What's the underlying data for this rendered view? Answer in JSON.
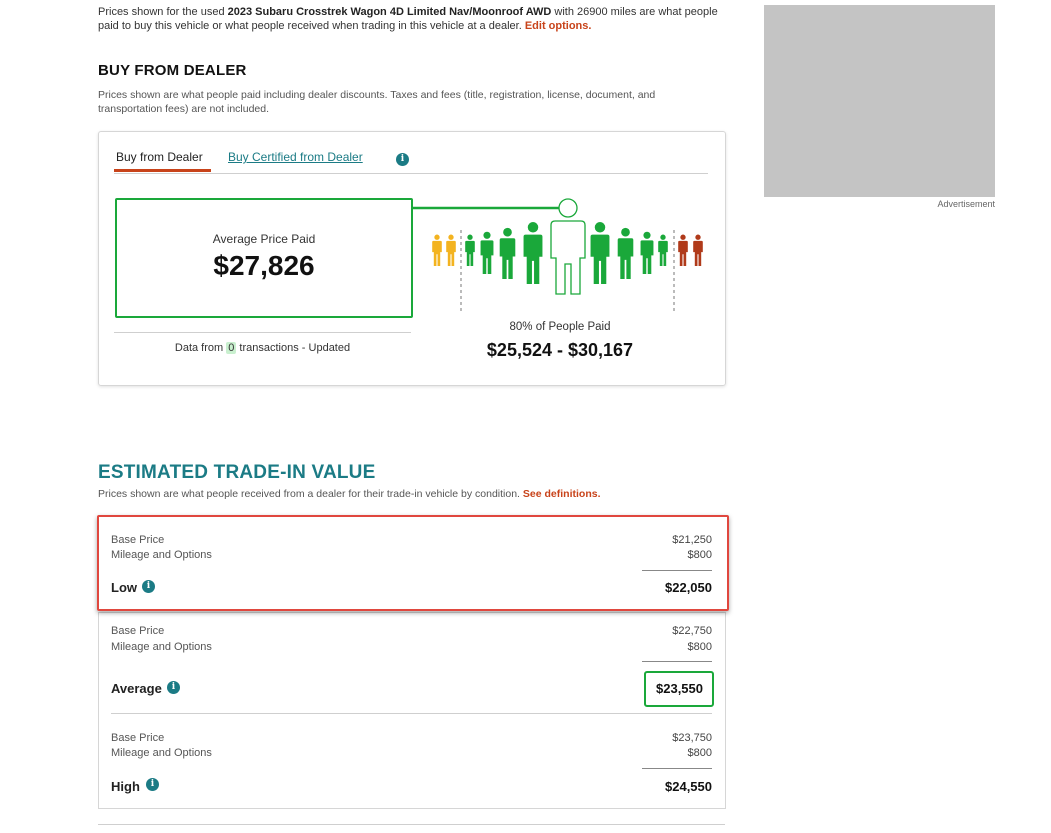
{
  "intro": {
    "prefix": "Prices shown for the used ",
    "vehicle": "2023 Subaru Crosstrek Wagon 4D Limited Nav/Moonroof AWD",
    "suffix": " with 26900 miles are what people paid to buy this vehicle or what people received when trading in this vehicle at a dealer. ",
    "edit_link": "Edit options."
  },
  "dealer": {
    "heading": "BUY FROM DEALER",
    "note": "Prices shown are what people paid including dealer discounts. Taxes and fees (title, registration, license, document, and transportation fees) are not included.",
    "tabs": [
      "Buy from Dealer",
      "Buy Certified from Dealer"
    ],
    "info_glyph": "i",
    "average_label": "Average Price Paid",
    "average_price": "$27,826",
    "data_from_prefix": "Data from ",
    "data_from_count": "0",
    "data_from_suffix": " transactions - Updated",
    "percent_label": "80% of People Paid",
    "price_range": "$25,524 - $30,167",
    "colors": {
      "low": "#f3b320",
      "mid": "#1aa83a",
      "high": "#b03a1a",
      "accent": "#c8431a"
    }
  },
  "trade": {
    "heading": "ESTIMATED TRADE-IN VALUE",
    "note_prefix": "Prices shown are what people received from a dealer for their trade-in vehicle by condition. ",
    "note_link": "See definitions.",
    "conditions": [
      {
        "name": "Low",
        "base_label": "Base Price",
        "base_value": "$21,250",
        "mileage_label": "Mileage and Options",
        "mileage_value": "$800",
        "total": "$22,050"
      },
      {
        "name": "Average",
        "base_label": "Base Price",
        "base_value": "$22,750",
        "mileage_label": "Mileage and Options",
        "mileage_value": "$800",
        "total": "$23,550"
      },
      {
        "name": "High",
        "base_label": "Base Price",
        "base_value": "$23,750",
        "mileage_label": "Mileage and Options",
        "mileage_value": "$800",
        "total": "$24,550"
      }
    ]
  },
  "ad": {
    "label": "Advertisement"
  }
}
